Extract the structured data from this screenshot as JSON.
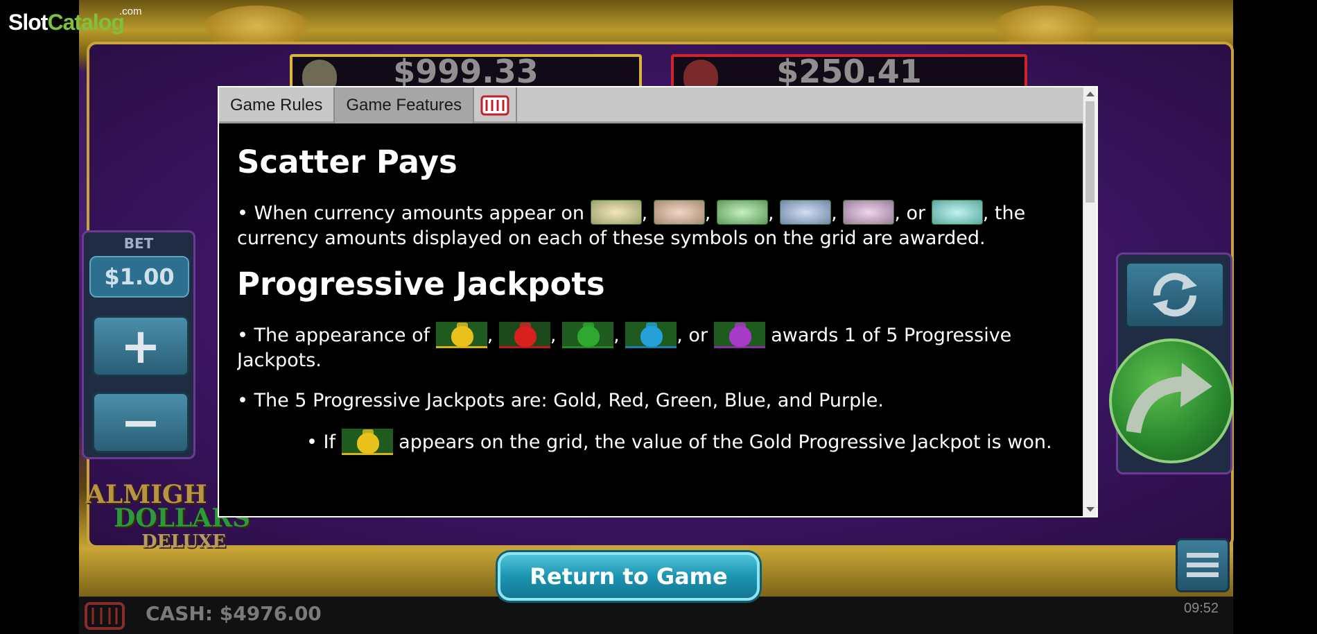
{
  "site": {
    "logo_slot": "Slot",
    "logo_catalog": "Catalog",
    "logo_com": ".com"
  },
  "game": {
    "jackpot_gold": "$999.33",
    "jackpot_red": "$250.41",
    "bet_label": "BET",
    "bet_value": "$1.00",
    "plus_label": "+",
    "minus_label": "−",
    "logo_line1": "ALMIGH",
    "logo_line2": "DOLLARS",
    "logo_line3": "DELUXE",
    "cash": "CASH: $4976.00",
    "clock": "09:52",
    "return_button": "Return to Game"
  },
  "dialog": {
    "tabs": [
      {
        "label": "Game Rules",
        "active": false
      },
      {
        "label": "Game Features",
        "active": true
      }
    ],
    "logo_icon": "dwg-logo-icon",
    "sections": {
      "scatter_title": "Scatter Pays",
      "scatter_p1_a": "• When currency amounts appear on",
      "scatter_sep": ",",
      "scatter_or": ", or",
      "scatter_p1_b": ", the currency amounts displayed on each of these symbols on the grid are awarded.",
      "jackpot_title": "Progressive Jackpots",
      "jackpot_p1_a": "• The appearance of",
      "jackpot_sep": ",",
      "jackpot_or": ", or",
      "jackpot_p1_b": "awards 1 of 5 Progressive Jackpots.",
      "jackpot_p2": "• The 5 Progressive Jackpots are: Gold, Red, Green, Blue, and Purple.",
      "jackpot_p3_a": "• If",
      "jackpot_p3_b": "appears on the grid, the value of the Gold Progressive Jackpot is won."
    },
    "currency_symbol_colors": [
      "#c8b87a",
      "#d6a68e",
      "#8ec88a",
      "#9fb4d4",
      "#c9a2c8",
      "#7fd4cc"
    ],
    "bag_colors": [
      "#e8c21a",
      "#d8201e",
      "#2ea82e",
      "#25a0d8",
      "#a83bc8"
    ]
  }
}
